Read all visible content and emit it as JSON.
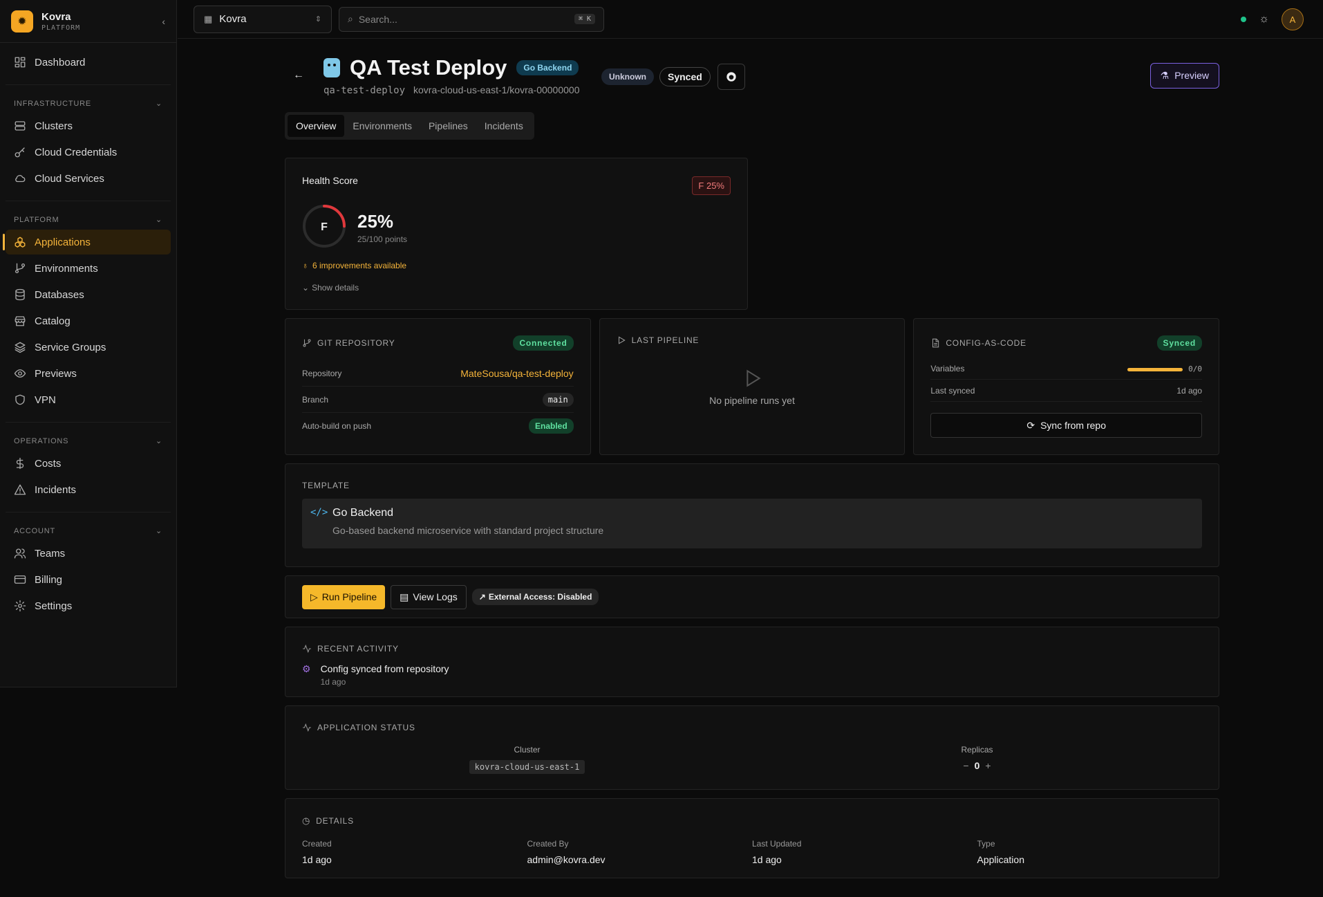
{
  "sidebar": {
    "brand": {
      "name": "Kovra",
      "sub": "PLATFORM"
    },
    "top": [
      {
        "label": "Dashboard"
      }
    ],
    "infrastructure": {
      "title": "INFRASTRUCTURE",
      "items": [
        {
          "label": "Clusters"
        },
        {
          "label": "Cloud Credentials"
        },
        {
          "label": "Cloud Services"
        }
      ]
    },
    "platform": {
      "title": "PLATFORM",
      "items": [
        {
          "label": "Applications"
        },
        {
          "label": "Environments"
        },
        {
          "label": "Databases"
        },
        {
          "label": "Catalog"
        },
        {
          "label": "Service Groups"
        },
        {
          "label": "Previews"
        },
        {
          "label": "VPN"
        }
      ]
    },
    "operations": {
      "title": "OPERATIONS",
      "items": [
        {
          "label": "Costs"
        },
        {
          "label": "Incidents"
        }
      ]
    },
    "account": {
      "title": "ACCOUNT",
      "items": [
        {
          "label": "Teams"
        },
        {
          "label": "Billing"
        },
        {
          "label": "Settings"
        }
      ]
    }
  },
  "topbar": {
    "org": "Kovra",
    "search_placeholder": "Search...",
    "shortcut": "⌘ K",
    "avatar": "A"
  },
  "header": {
    "title": "QA Test Deploy",
    "template_badge": "Go Backend",
    "slug": "qa-test-deploy",
    "cluster_path": "kovra-cloud-us-east-1/kovra-00000000",
    "status_unknown": "Unknown",
    "status_synced": "Synced",
    "preview": "Preview"
  },
  "tabs": [
    "Overview",
    "Environments",
    "Pipelines",
    "Incidents"
  ],
  "health": {
    "title": "Health Score",
    "grade": "F",
    "badge": "F 25%",
    "percent": "25%",
    "percent_value": 0.25,
    "points": "25/100 points",
    "improvements": "6 improvements available",
    "show_details": "Show details"
  },
  "git": {
    "title": "GIT REPOSITORY",
    "status": "Connected",
    "repo_label": "Repository",
    "repo": "MateSousa/qa-test-deploy",
    "branch_label": "Branch",
    "branch": "main",
    "autobuild_label": "Auto-build on push",
    "autobuild": "Enabled"
  },
  "pipeline": {
    "title": "LAST PIPELINE",
    "empty": "No pipeline runs yet"
  },
  "config": {
    "title": "CONFIG-AS-CODE",
    "status": "Synced",
    "vars_label": "Variables",
    "vars": "0/0",
    "synced_label": "Last synced",
    "synced": "1d ago",
    "sync_btn": "Sync from repo"
  },
  "template": {
    "title": "TEMPLATE",
    "name": "Go Backend",
    "desc": "Go-based backend microservice with standard project structure"
  },
  "actions": {
    "run": "Run Pipeline",
    "logs": "View Logs",
    "external": "External Access: Disabled"
  },
  "activity": {
    "title": "RECENT ACTIVITY",
    "item": "Config synced from repository",
    "time": "1d ago"
  },
  "app_status": {
    "title": "APPLICATION STATUS",
    "cluster_label": "Cluster",
    "cluster": "kovra-cloud-us-east-1",
    "replicas_label": "Replicas",
    "replicas": "0"
  },
  "details": {
    "title": "DETAILS",
    "cols": [
      {
        "label": "Created",
        "value": "1d ago"
      },
      {
        "label": "Created By",
        "value": "admin@kovra.dev"
      },
      {
        "label": "Last Updated",
        "value": "1d ago"
      },
      {
        "label": "Type",
        "value": "Application"
      }
    ]
  }
}
